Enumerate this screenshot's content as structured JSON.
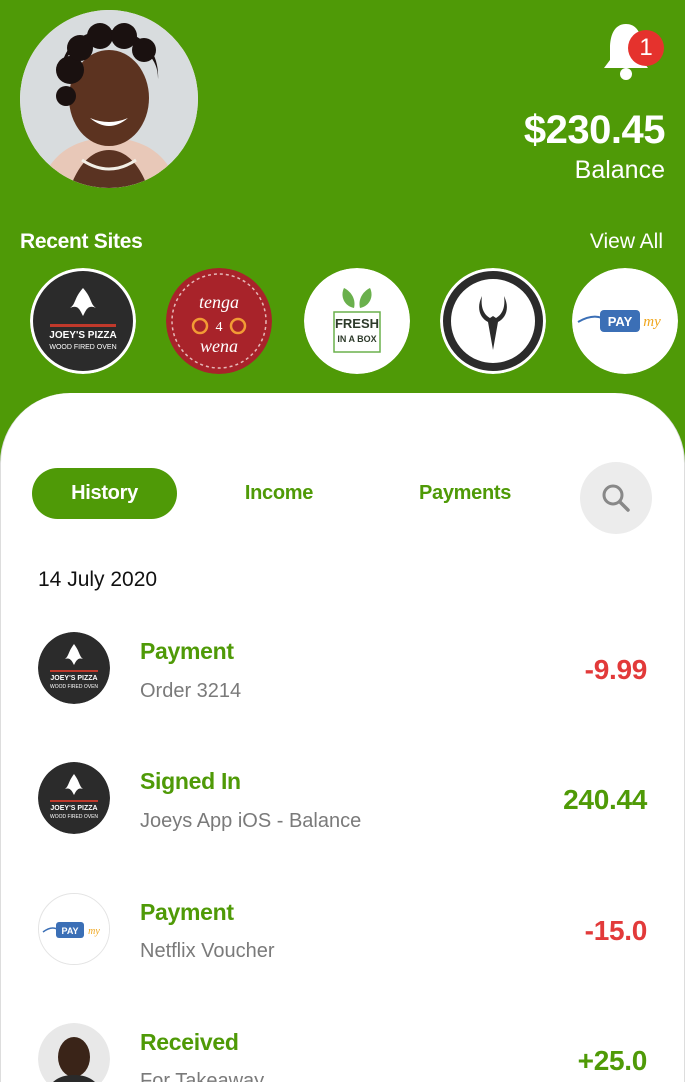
{
  "header": {
    "balance_amount": "$230.45",
    "balance_label": "Balance",
    "notification_count": "1",
    "recent_sites_title": "Recent Sites",
    "view_all_label": "View All"
  },
  "recent_sites": [
    {
      "name": "JOEY'S PIZZA",
      "sub": "WOOD FIRED OVEN"
    },
    {
      "name": "tenga",
      "sub": "wena"
    },
    {
      "name": "FRESH",
      "sub": "IN A BOX"
    },
    {
      "name": "antelope-logo"
    },
    {
      "name": "PAY",
      "sub": "my"
    }
  ],
  "tabs": {
    "history": "History",
    "income": "Income",
    "payments": "Payments"
  },
  "date_header": "14 July 2020",
  "transactions": [
    {
      "title": "Payment",
      "subtitle": "Order 3214",
      "amount": "-9.99",
      "logo": "joeys-pizza-logo"
    },
    {
      "title": "Signed In",
      "subtitle": "Joeys App iOS - Balance",
      "amount": "240.44",
      "logo": "joeys-pizza-logo"
    },
    {
      "title": "Payment",
      "subtitle": "Netflix Voucher",
      "amount": "-15.0",
      "logo": "paymy-logo"
    },
    {
      "title": "Received",
      "subtitle": "For Takeaway",
      "amount": "+25.0",
      "logo": "person-avatar"
    }
  ],
  "colors": {
    "brand_green": "#4f9a07",
    "negative_red": "#e23a3a",
    "badge_red": "#e5322d"
  }
}
